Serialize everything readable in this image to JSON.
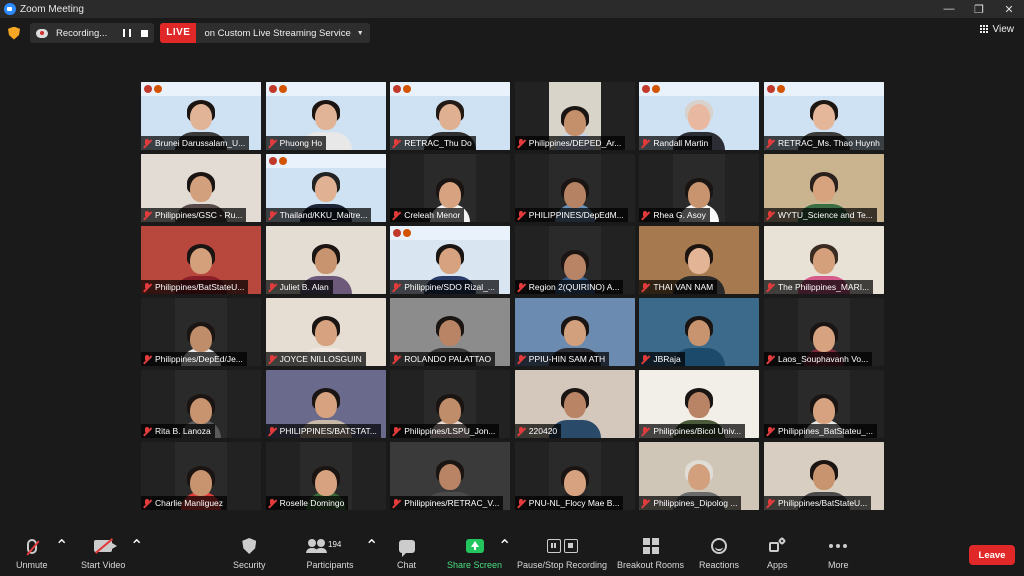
{
  "window": {
    "title": "Zoom Meeting"
  },
  "topbar": {
    "recording_label": "Recording...",
    "live_badge": "LIVE",
    "live_service": "on Custom Live Streaming Service",
    "view_label": "View"
  },
  "participants": [
    {
      "name": "Brunei Darussalam_U...",
      "bg": "#cfe2f3",
      "banner": true,
      "skin": "#e2b497",
      "hair": "#1b1411",
      "shirt": "#3a3a3a"
    },
    {
      "name": "Phuong Ho",
      "bg": "#cfe2f3",
      "banner": true,
      "skin": "#e2b497",
      "hair": "#1b1411",
      "shirt": "#e8e8e8"
    },
    {
      "name": "RETRAC_Thu Do",
      "bg": "#cfe2f3",
      "banner": true,
      "skin": "#e0b092",
      "hair": "#231a15",
      "shirt": "#2f2f2f"
    },
    {
      "name": "Philippines/DEPED_Ar...",
      "bg": "#d9d4c9",
      "banner": false,
      "skin": "#c48f6b",
      "hair": "#1a1412",
      "shirt": "#c7d4e8",
      "small": true
    },
    {
      "name": "Randall Martin",
      "bg": "#cfe2f3",
      "banner": true,
      "skin": "#e8b8a0",
      "hair": "#d8d2cc",
      "shirt": "#2c2c34"
    },
    {
      "name": "RETRAC_Ms. Thao Huynh",
      "bg": "#cfe2f3",
      "banner": true,
      "skin": "#e4b69a",
      "hair": "#1c1512",
      "shirt": "#3b3b3b",
      "active": true
    },
    {
      "name": "Philippines/GSC - Ru...",
      "bg": "#e2dcd4",
      "banner": false,
      "skin": "#d2a07c",
      "hair": "#1a1412",
      "shirt": "#5a4b4b"
    },
    {
      "name": "Thailand/KKU_Maitre...",
      "bg": "#cfe2f3",
      "banner": true,
      "skin": "#e0b293",
      "hair": "#222",
      "shirt": "#1c2436"
    },
    {
      "name": "Creleah Menor",
      "bg": "#2a2a2a",
      "banner": false,
      "skin": "#d6a27f",
      "hair": "#1a1412",
      "shirt": "#f2f2f2",
      "small": true
    },
    {
      "name": "PHILIPPINES/DepEdM...",
      "bg": "#2a2a2a",
      "banner": false,
      "skin": "#b58363",
      "hair": "#1a1412",
      "shirt": "#6a8fb8",
      "small": true
    },
    {
      "name": "Rhea G. Asoy",
      "bg": "#2a2a2a",
      "banner": false,
      "skin": "#c8946f",
      "hair": "#1a1412",
      "shirt": "#fafafa",
      "small": true
    },
    {
      "name": "WYTU_Science and Te...",
      "bg": "#c9b48f",
      "banner": false,
      "skin": "#d7a37e",
      "hair": "#2a211d",
      "shirt": "#3c6e45"
    },
    {
      "name": "Philippines/BatStateU...",
      "bg": "#b8483d",
      "banner": false,
      "skin": "#d4a07c",
      "hair": "#1a1412",
      "shirt": "#8a1f2a"
    },
    {
      "name": "Juliet B. Alan",
      "bg": "#e3ddd4",
      "banner": false,
      "skin": "#c8946f",
      "hair": "#1a1412",
      "shirt": "#6d5a7a"
    },
    {
      "name": "Philippine/SDO Rizal_...",
      "bg": "#d9e6f2",
      "banner": true,
      "skin": "#d6a27f",
      "hair": "#1a1412",
      "shirt": "#2a3c6a"
    },
    {
      "name": "Region 2(QUIRINO) A...",
      "bg": "#2a2a2a",
      "banner": false,
      "skin": "#b98465",
      "hair": "#1a1412",
      "shirt": "#3a5e8c",
      "small": true
    },
    {
      "name": "THAI VAN NAM",
      "bg": "#a67a4e",
      "banner": false,
      "skin": "#e4b496",
      "hair": "#1b1411",
      "shirt": "#2a2a2a"
    },
    {
      "name": "The Philippines_MARI...",
      "bg": "#e8e1d6",
      "banner": false,
      "skin": "#d4a07c",
      "hair": "#3a2b22",
      "shirt": "#d65c8c"
    },
    {
      "name": "Philippines/DepEd/Je...",
      "bg": "#2a2a2a",
      "banner": false,
      "skin": "#c08d6a",
      "hair": "#1a1412",
      "shirt": "#e8e8e8",
      "small": true
    },
    {
      "name": "JOYCE NILLOSGUIN",
      "bg": "#e6ddd3",
      "banner": false,
      "skin": "#d6a27f",
      "hair": "#1a1412",
      "shirt": "#f0e8e0"
    },
    {
      "name": "ROLANDO PALATTAO",
      "bg": "#8c8c8c",
      "banner": false,
      "skin": "#b98465",
      "hair": "#1a1412",
      "shirt": "#3a3a3a"
    },
    {
      "name": "PPIU-HIN SAM ATH",
      "bg": "#6b8bb0",
      "banner": false,
      "skin": "#d2a07c",
      "hair": "#1a1412",
      "shirt": "#2c2c34"
    },
    {
      "name": "JBRaja",
      "bg": "#3b6a8a",
      "banner": false,
      "skin": "#c8946f",
      "hair": "#1a1412",
      "shirt": "#1c4a6a"
    },
    {
      "name": "Laos_Souphavanh Vo...",
      "bg": "#2a2a2a",
      "banner": false,
      "skin": "#d6a27f",
      "hair": "#1a1412",
      "shirt": "#7a2a3a",
      "small": true
    },
    {
      "name": "Rita B. Lanoza",
      "bg": "#2a2a2a",
      "banner": false,
      "skin": "#c8946f",
      "hair": "#1a1412",
      "shirt": "#5a5a5a",
      "small": true
    },
    {
      "name": "PHILIPPINES/BATSTAT...",
      "bg": "#6a6a8c",
      "banner": false,
      "skin": "#d6a27f",
      "hair": "#1a1412",
      "shirt": "#c8b8a8"
    },
    {
      "name": "Philippines/LSPU_Jon...",
      "bg": "#2a2a2a",
      "banner": false,
      "skin": "#c08d6a",
      "hair": "#1a1412",
      "shirt": "#e8d8d0",
      "small": true
    },
    {
      "name": "220420",
      "bg": "#d4c8bc",
      "banner": false,
      "skin": "#b98465",
      "hair": "#1a1412",
      "shirt": "#2a4a6a"
    },
    {
      "name": "Philippines/Bicol Univ...",
      "bg": "#f2efe8",
      "banner": false,
      "skin": "#b98465",
      "hair": "#1a1412",
      "shirt": "#4a5a3a"
    },
    {
      "name": "Philippines_BatStateu_...",
      "bg": "#2a2a2a",
      "banner": false,
      "skin": "#d6a27f",
      "hair": "#1a1412",
      "shirt": "#e8e8e8",
      "small": true
    },
    {
      "name": "Charlie Manliguez",
      "bg": "#2a2a2a",
      "banner": false,
      "skin": "#c8946f",
      "hair": "#1a1412",
      "shirt": "#e23b3b",
      "small": true
    },
    {
      "name": "Roselle Domingo",
      "bg": "#2a2a2a",
      "banner": false,
      "skin": "#d6a27f",
      "hair": "#1a1412",
      "shirt": "#3a6a3a",
      "small": true
    },
    {
      "name": "Philippines/RETRAC_V...",
      "bg": "#3a3a3a",
      "banner": false,
      "skin": "#b98465",
      "hair": "#1a1412",
      "shirt": "#4a4a4a"
    },
    {
      "name": "PNU-NL_Flocy Mae B...",
      "bg": "#2a2a2a",
      "banner": false,
      "skin": "#d6a27f",
      "hair": "#1a1412",
      "shirt": "#222",
      "small": true
    },
    {
      "name": "Philippines_Dipolog ...",
      "bg": "#cfc6b8",
      "banner": false,
      "skin": "#d2a07c",
      "hair": "#e0dcd6",
      "shirt": "#6a6a6a"
    },
    {
      "name": "Philippines/BatStateU...",
      "bg": "#d8cfc2",
      "banner": false,
      "skin": "#c8946f",
      "hair": "#1a1412",
      "shirt": "#4a4a4a"
    }
  ],
  "toolbar": {
    "unmute": "Unmute",
    "start_video": "Start Video",
    "security": "Security",
    "participants": "Participants",
    "participants_count": "194",
    "chat": "Chat",
    "share_screen": "Share Screen",
    "pause_stop_recording": "Pause/Stop Recording",
    "breakout_rooms": "Breakout Rooms",
    "reactions": "Reactions",
    "apps": "Apps",
    "more": "More",
    "leave": "Leave"
  }
}
